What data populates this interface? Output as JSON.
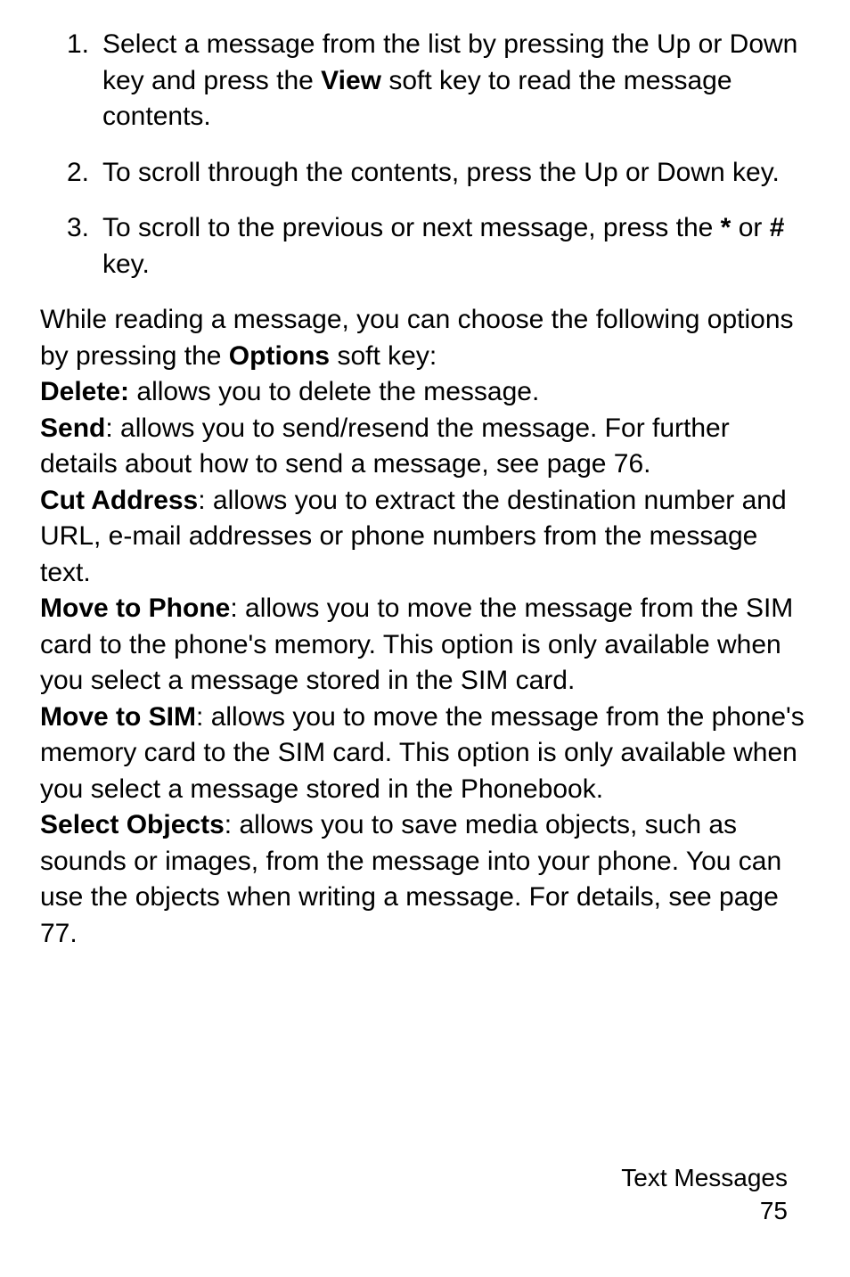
{
  "steps": [
    {
      "num": "1.",
      "pre": "Select a message from the list by pressing the Up or Down key and press the ",
      "bold": "View",
      "post": " soft key to read the message contents."
    },
    {
      "num": "2.",
      "text": "To scroll through the contents, press the Up or Down key."
    },
    {
      "num": "3.",
      "pre": "To scroll to the previous or next message, press the ",
      "sym1": "*",
      "mid1": " or ",
      "sym2": "#",
      "post1": " key."
    }
  ],
  "intro": {
    "pre": "While reading a message, you can choose the following options by pressing the ",
    "bold": "Options",
    "post": " soft key:"
  },
  "opts": {
    "delete": {
      "label": "Delete:",
      "text": " allows you to delete the message."
    },
    "send": {
      "label": "Send",
      "colon": ": ",
      "text": "allows you to send/resend the message. For further details about how to send a message, see page 76."
    },
    "cut": {
      "label": "Cut Address",
      "colon": ": ",
      "text": "allows you to extract the destination number and URL, e-mail addresses or phone numbers from the message text."
    },
    "movePhone": {
      "label": "Move to Phone",
      "colon": ": ",
      "text": "allows you to move the message from the SIM card to the phone's memory. This option is only available when you select a message stored in the SIM card."
    },
    "moveSim": {
      "label": "Move to SIM",
      "colon": ": ",
      "text": "allows you to move the message from the phone's memory card to the SIM card. This option is only available when you select a message stored in the Phonebook."
    },
    "selObj": {
      "label": "Select Objects",
      "colon": ": ",
      "text": "allows you to save media objects, such as sounds or images, from the message into your phone. You can use the objects when writing a message. For details, see page 77."
    }
  },
  "footer": {
    "section": "Text Messages",
    "page": "75"
  }
}
